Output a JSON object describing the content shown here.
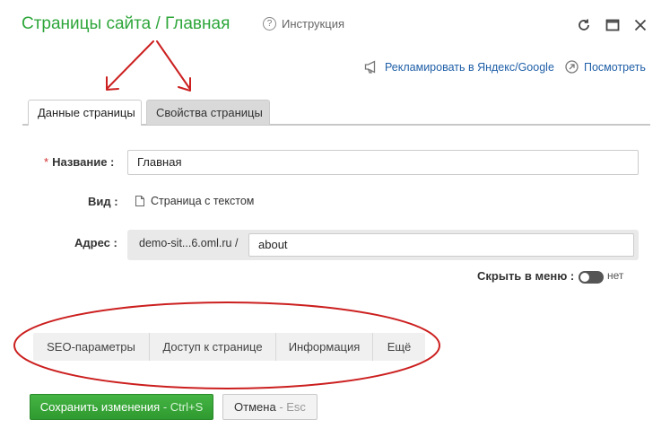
{
  "header": {
    "title": "Страницы сайта / Главная",
    "help_icon": "question-circle-icon",
    "help_label": "Инструкция",
    "window_controls": [
      "refresh-icon",
      "maximize-icon",
      "close-icon"
    ]
  },
  "top_links": {
    "advertise_label": "Рекламировать в Яндекс/Google",
    "advertise_icon": "megaphone-icon",
    "view_label": "Посмотреть",
    "view_icon": "arrow-up-right-circle-icon"
  },
  "tabs": [
    {
      "label": "Данные страницы",
      "active": true
    },
    {
      "label": "Свойства страницы",
      "active": false
    }
  ],
  "form": {
    "name_required_mark": "*",
    "name_label": "Название :",
    "name_value": "Главная",
    "type_label": "Вид :",
    "type_icon": "document-icon",
    "type_value": "Страница с текстом",
    "address_label": "Адрес :",
    "address_prefix": "demo-sit...6.oml.ru /",
    "address_value": "about",
    "hide_in_menu_label": "Скрыть в меню :",
    "hide_in_menu_state": "нет"
  },
  "sub_tabs": [
    {
      "label": "SEO-параметры"
    },
    {
      "label": "Доступ к странице"
    },
    {
      "label": "Информация"
    },
    {
      "label": "Ещё"
    }
  ],
  "buttons": {
    "save_label": "Сохранить изменения",
    "save_hint": " - Ctrl+S",
    "cancel_label": "Отмена",
    "cancel_hint": " - Esc"
  },
  "colors": {
    "title_green": "#2ea63a",
    "link_blue": "#1f5fa8",
    "save_green": "#3aa33a",
    "annotation_red": "#cc1f1f"
  }
}
